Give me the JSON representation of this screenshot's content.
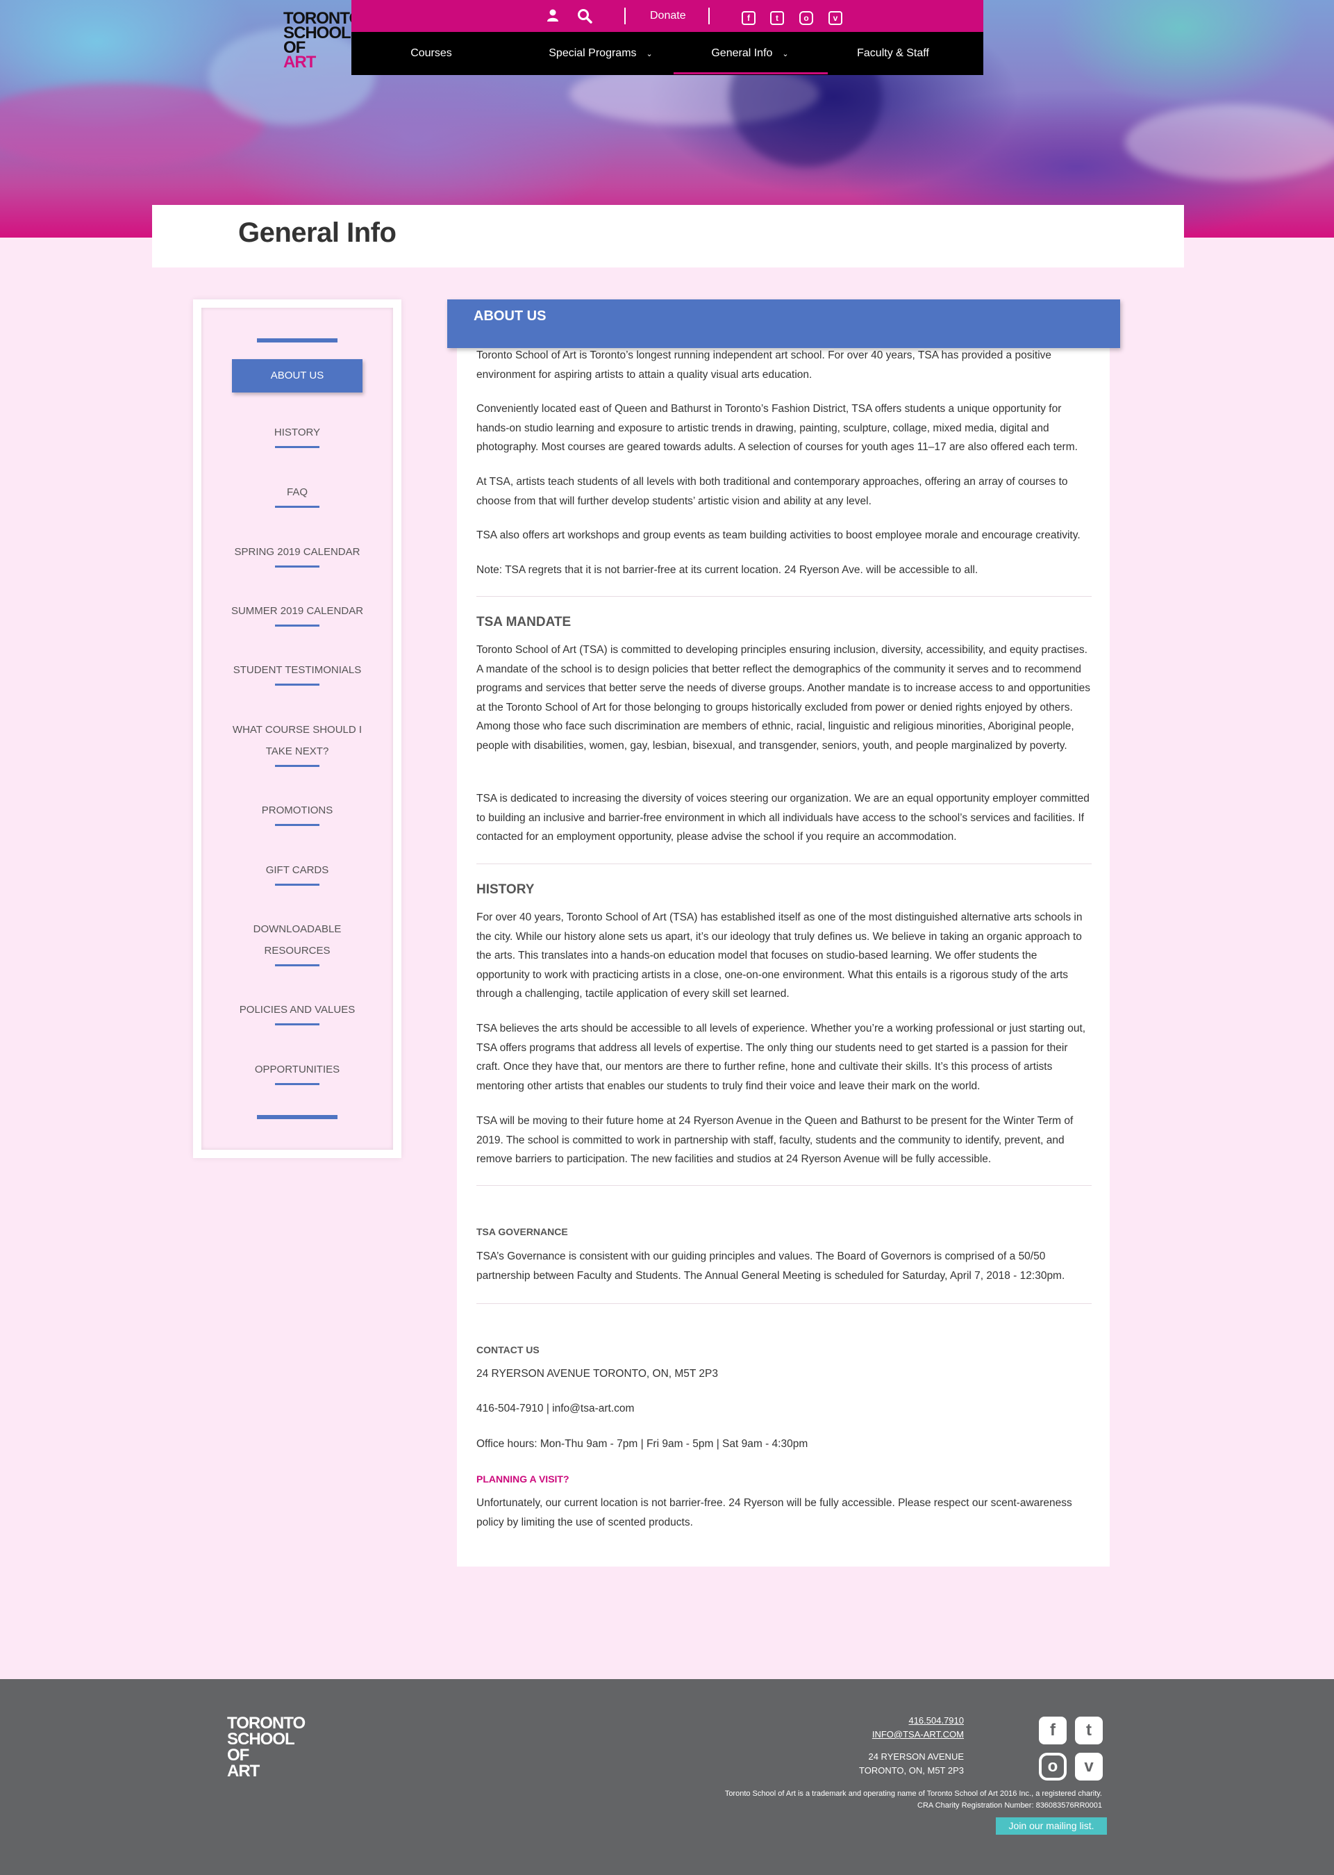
{
  "brand": {
    "logo_lines": [
      "TORONTO",
      "SCHOOL",
      "OF",
      "ART"
    ],
    "accent": "#cc0a7c",
    "blue": "#4f74c2"
  },
  "topbar": {
    "donate_label": "Donate",
    "icons": [
      "user-icon",
      "search-icon",
      "facebook-icon",
      "twitter-icon",
      "instagram-icon",
      "vimeo-icon"
    ]
  },
  "nav": {
    "items": [
      {
        "label": "Courses"
      },
      {
        "label": "Special Programs"
      },
      {
        "label": "General Info"
      },
      {
        "label": "Faculty & Staff"
      }
    ]
  },
  "page_title": "General Info",
  "sidebar": {
    "active": "ABOUT US",
    "items": [
      "HISTORY",
      "FAQ",
      "SPRING 2019 CALENDAR",
      "SUMMER 2019 CALENDAR",
      "STUDENT TESTIMONIALS",
      "WHAT COURSE SHOULD I",
      "TAKE NEXT?",
      "PROMOTIONS",
      "GIFT CARDS",
      "DOWNLOADABLE",
      "RESOURCES",
      "POLICIES AND VALUES",
      "OPPORTUNITIES"
    ]
  },
  "main": {
    "header": "ABOUT US",
    "about": [
      "Toronto School of Art is Toronto’s longest running independent art school. For over 40 years, TSA has provided a positive environment for aspiring artists to attain a quality visual arts education.",
      "Conveniently located east of Queen and Bathurst in Toronto’s Fashion District, TSA offers students a unique opportunity for hands-on studio learning and exposure to artistic trends in drawing, painting, sculpture, collage, mixed media, digital and photography. Most courses are geared towards adults. A selection of courses for youth ages 11–17 are also offered each term.",
      "At TSA, artists teach students of all levels with both traditional and contemporary approaches, offering an array of courses to choose from that will further develop students’ artistic vision and ability at any level.",
      "TSA also offers art workshops and group events as team building activities to boost employee morale and encourage creativity.",
      "Note: TSA regrets that it is not barrier-free at its current location. 24 Ryerson Ave. will be accessible to all."
    ],
    "mandate_title": "TSA MANDATE",
    "mandate": [
      "Toronto School of Art (TSA) is committed to developing principles ensuring inclusion, diversity, accessibility, and equity practises. A mandate of the school is to design policies that better reflect the demographics of the community it serves and to recommend programs and services that better serve the needs of diverse groups. Another mandate is to increase access to and opportunities at the Toronto School of Art for those belonging to groups historically excluded from power or denied rights enjoyed by others. Among those who face such discrimination are members of ethnic, racial, linguistic and religious minorities, Aboriginal people, people with disabilities, women, gay, lesbian, bisexual, and transgender, seniors, youth, and people marginalized by poverty.",
      "TSA is dedicated to increasing the diversity of voices steering our organization. We are an equal opportunity employer committed to building an inclusive and barrier-free environment in which all individuals have access to the school’s services and facilities. If contacted for an employment opportunity, please advise the school if you require an accommodation."
    ],
    "history_title": "HISTORY",
    "history": [
      "For over 40 years, Toronto School of Art (TSA) has established itself as one of the most distinguished alternative arts schools in the city. While our history alone sets us apart, it’s our ideology that truly defines us. We believe in taking an organic approach to the arts. This translates into a hands-on education model that focuses on studio-based learning. We offer students the opportunity to work with practicing artists in a close, one-on-one environment. What this entails is a rigorous study of the arts through a challenging, tactile application of every skill set learned.",
      "TSA believes the arts should be accessible to all levels of experience. Whether you’re a working professional or just starting out, TSA offers programs that address all levels of expertise. The only thing our students need to get started is a passion for their craft. Once they have that, our mentors are there to further refine, hone and cultivate their skills. It’s this process of artists mentoring other artists that enables our students to truly find their voice and leave their mark on the world.",
      "TSA will be moving to their future home at 24 Ryerson Avenue in the Queen and Bathurst to be present for the Winter Term of 2019. The school is committed to work in partnership with staff, faculty, students and the community to identify, prevent, and remove barriers to participation. The new facilities and studios at 24 Ryerson Avenue will be fully accessible."
    ],
    "governance_title": "TSA GOVERNANCE",
    "governance": "TSA’s Governance is consistent with our guiding principles and values. The Board of Governors is comprised of a 50/50 partnership between Faculty and Students. The Annual General Meeting is scheduled for Saturday, April 7, 2018 - 12:30pm.",
    "contact_title": "CONTACT US",
    "address": "24 RYERSON AVENUE TORONTO, ON, M5T 2P3",
    "phone_email": "416-504-7910 | info@tsa-art.com",
    "hours": "Office hours: Mon-Thu 9am - 7pm | Fri 9am - 5pm | Sat 9am - 4:30pm",
    "visit_title": "PLANNING A VISIT?",
    "visit": "Unfortunately, our current location is not barrier-free. 24 Ryerson will be fully accessible. Please respect our scent-awareness policy by limiting the use of scented products."
  },
  "footer": {
    "logo_lines": [
      "TORONTO",
      "SCHOOL",
      "OF",
      "ART"
    ],
    "phone": "416.504.7910",
    "email": "INFO@TSA-ART.COM",
    "address_1": "24 RYERSON AVENUE",
    "address_2": "TORONTO, ON, M5T 2P3",
    "legal_1": "Toronto School of Art is a trademark and operating name of Toronto School of Art 2016 Inc., a registered charity.",
    "legal_2": "CRA Charity Registration Number: 836083576RR0001",
    "mailing_label": "Join our mailing list.",
    "mailing_color": "#4cc2c4",
    "background": "#636466"
  }
}
